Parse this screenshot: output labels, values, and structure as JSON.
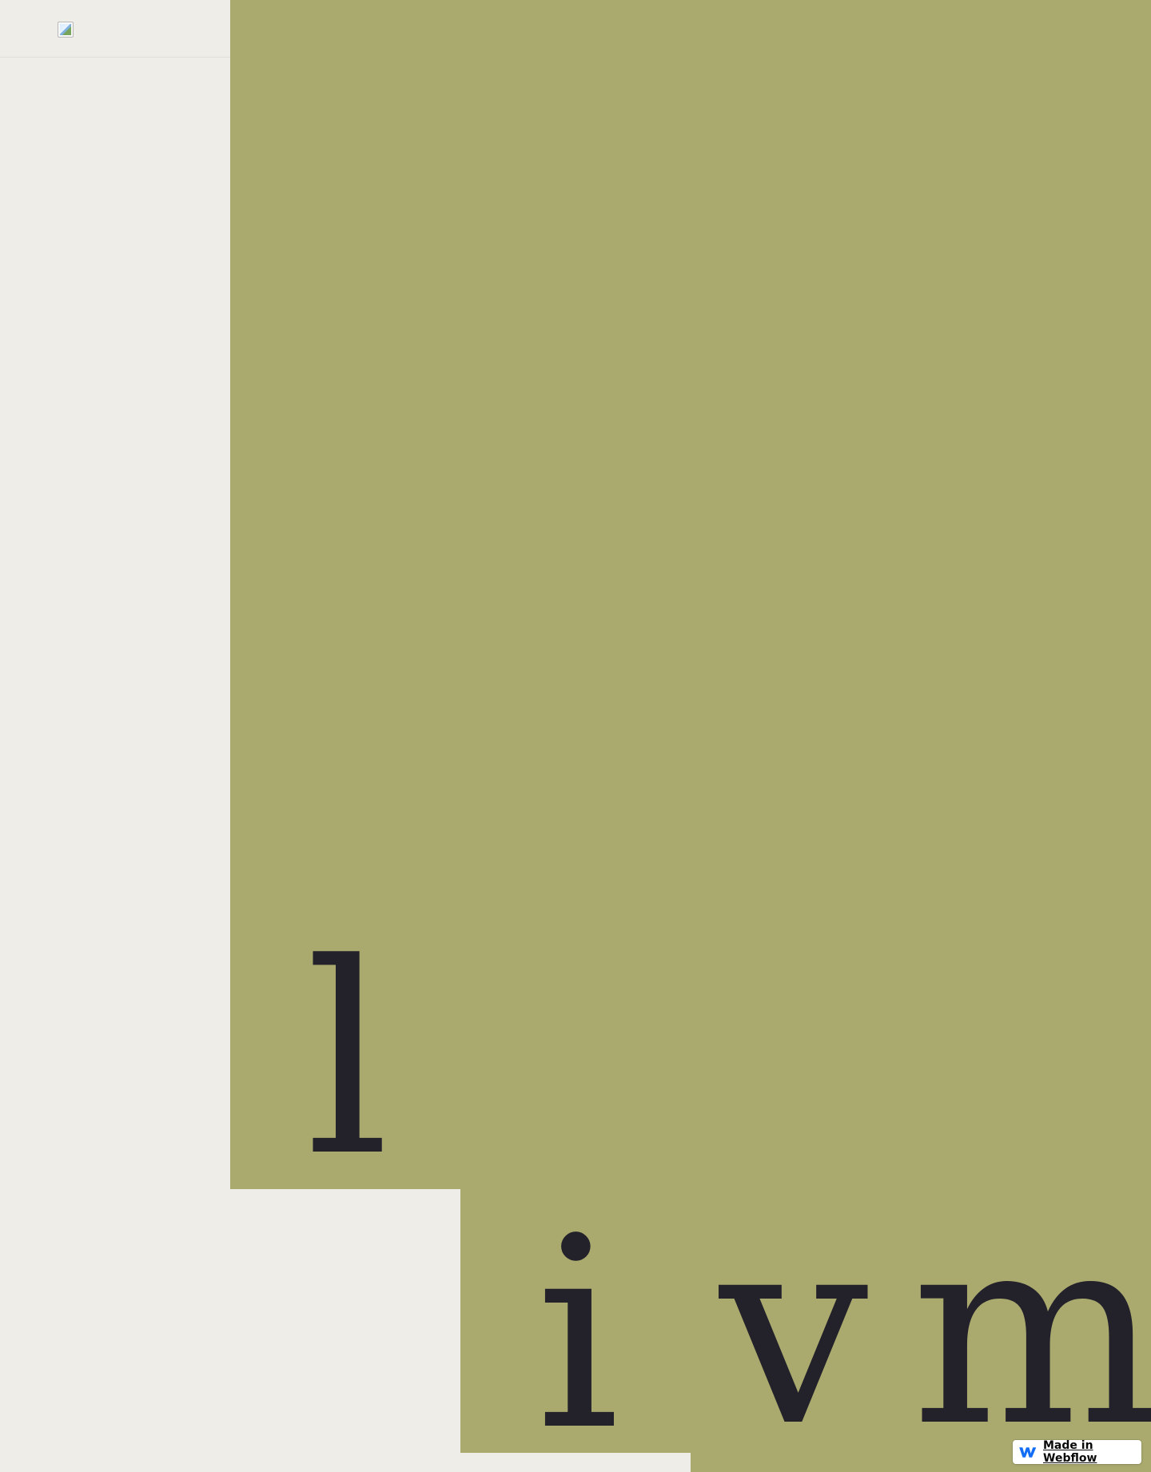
{
  "logo": {
    "label": "broken-image-icon"
  },
  "hero": {
    "letters": [
      "l",
      "i",
      "v",
      "m"
    ]
  },
  "badge": {
    "label": "Made in Webflow",
    "icon": "webflow-logo-icon"
  },
  "colors": {
    "background": "#EEEDE7",
    "accent_olive": "#AAAA6F",
    "text_dark": "#23212A",
    "badge_blue": "#146EF5"
  }
}
